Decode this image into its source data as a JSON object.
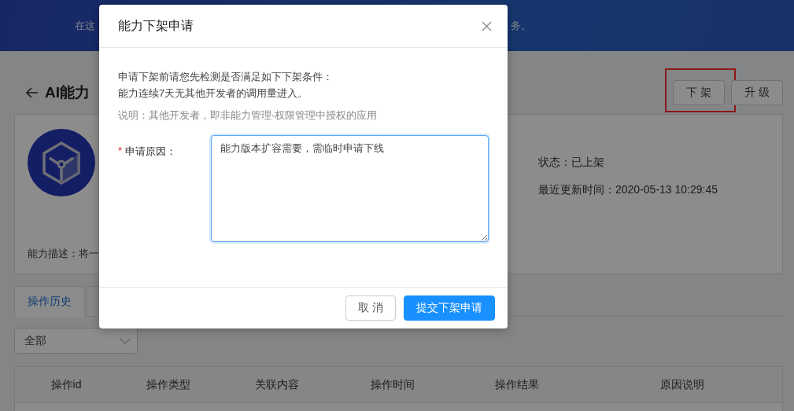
{
  "header": {
    "subtitle_start": "在这",
    "subtitle_end": "务。"
  },
  "page": {
    "title": "AI能力",
    "actions": [
      {
        "label": "下 架",
        "highlighted": true
      },
      {
        "label": "升 级",
        "highlighted": false
      }
    ],
    "status": "状态：已上架",
    "updated": "最近更新时间：2020-05-13 10:29:45",
    "description": "能力描述：将一"
  },
  "tabs": [
    {
      "label": "操作历史",
      "selected": true
    }
  ],
  "filter": {
    "value": "全部"
  },
  "table": {
    "columns": [
      "操作id",
      "操作类型",
      "关联内容",
      "操作时间",
      "操作结果",
      "原因说明"
    ]
  },
  "dialog": {
    "title": "能力下架申请",
    "notice": [
      "申请下架前请您先检测是否满足如下下架条件：",
      "能力连续7天无其他开发者的调用量进入。"
    ],
    "note": "说明：其他开发者，即非能力管理-权限管理中授权的应用",
    "field": {
      "label": "申请原因：",
      "required_mark": "*",
      "value": "能力版本扩容需要，需临时申请下线"
    },
    "buttons": [
      {
        "label": "取 消",
        "kind": "default"
      },
      {
        "label": "提交下架申请",
        "kind": "primary"
      }
    ]
  }
}
